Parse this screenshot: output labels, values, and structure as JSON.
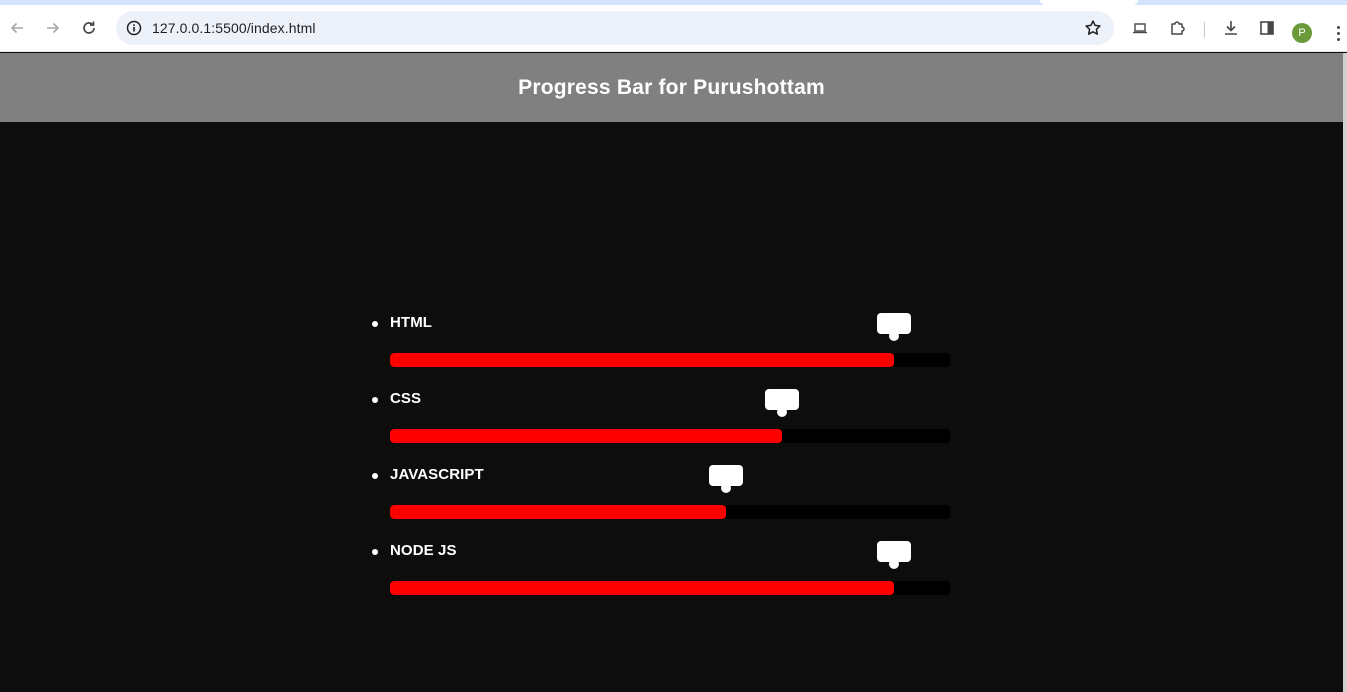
{
  "browser": {
    "url": "127.0.0.1:5500/index.html",
    "profile_initial": "P",
    "profile_color": "#6a9a3a"
  },
  "page": {
    "title": "Progress Bar for Purushottam",
    "accent_color": "#ff0000"
  },
  "skills": [
    {
      "name": "HTML",
      "percent": 90
    },
    {
      "name": "CSS",
      "percent": 70
    },
    {
      "name": "JAVASCRIPT",
      "percent": 60
    },
    {
      "name": "NODE JS",
      "percent": 90
    }
  ]
}
